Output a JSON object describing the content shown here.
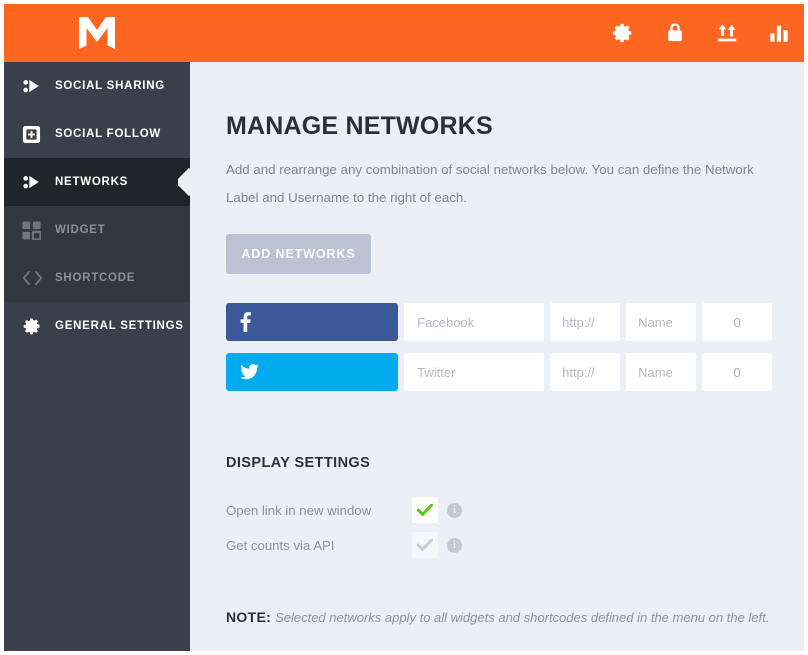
{
  "header": {
    "logo": "M",
    "brand_color": "#fc6621",
    "icons": [
      {
        "name": "gear-icon",
        "label": "Settings"
      },
      {
        "name": "lock-icon",
        "label": "License"
      },
      {
        "name": "import-export-icon",
        "label": "Import / Export"
      },
      {
        "name": "stats-icon",
        "label": "Statistics"
      }
    ]
  },
  "sidebar": {
    "background": "#3a3f4b",
    "active_background": "#212429",
    "items": [
      {
        "label": "SOCIAL SHARING",
        "icon": "share-node-icon",
        "active": false,
        "dim": false
      },
      {
        "label": "SOCIAL FOLLOW",
        "icon": "plus-square-icon",
        "active": false,
        "dim": false
      },
      {
        "label": "NETWORKS",
        "icon": "share-node-icon",
        "active": true,
        "dim": false
      },
      {
        "label": "WIDGET",
        "icon": "grid-icon",
        "active": false,
        "dim": true
      },
      {
        "label": "SHORTCODE",
        "icon": "code-brackets-icon",
        "active": false,
        "dim": true
      },
      {
        "label": "GENERAL SETTINGS",
        "icon": "gear-icon",
        "active": false,
        "dim": false
      }
    ]
  },
  "main": {
    "title": "MANAGE NETWORKS",
    "description": "Add and rearrange any combination of social networks below. You can define the Network Label and Username to the right of each.",
    "add_button": "ADD NETWORKS",
    "networks": [
      {
        "name": "Facebook",
        "glyph": "f",
        "color": "#3b5998",
        "label_placeholder": "Facebook",
        "label_value": "",
        "url_placeholder": "http://",
        "url_value": "",
        "username_placeholder": "Name",
        "username_value": "",
        "count": "0"
      },
      {
        "name": "Twitter",
        "glyph": "twitter-bird",
        "color": "#00aced",
        "label_placeholder": "Twitter",
        "label_value": "",
        "url_placeholder": "http://",
        "url_value": "",
        "username_placeholder": "Name",
        "username_value": "",
        "count": "0"
      }
    ],
    "display_settings": {
      "title": "DISPLAY SETTINGS",
      "options": [
        {
          "label": "Open link in new window",
          "checked": true,
          "enabled": true,
          "check_color": "#56c910"
        },
        {
          "label": "Get counts via API",
          "checked": true,
          "enabled": false,
          "check_color": "#c9ced8"
        }
      ]
    },
    "note": {
      "prefix": "NOTE:",
      "text": "Selected networks apply to all widgets and shortcodes defined in the menu on the left."
    }
  }
}
